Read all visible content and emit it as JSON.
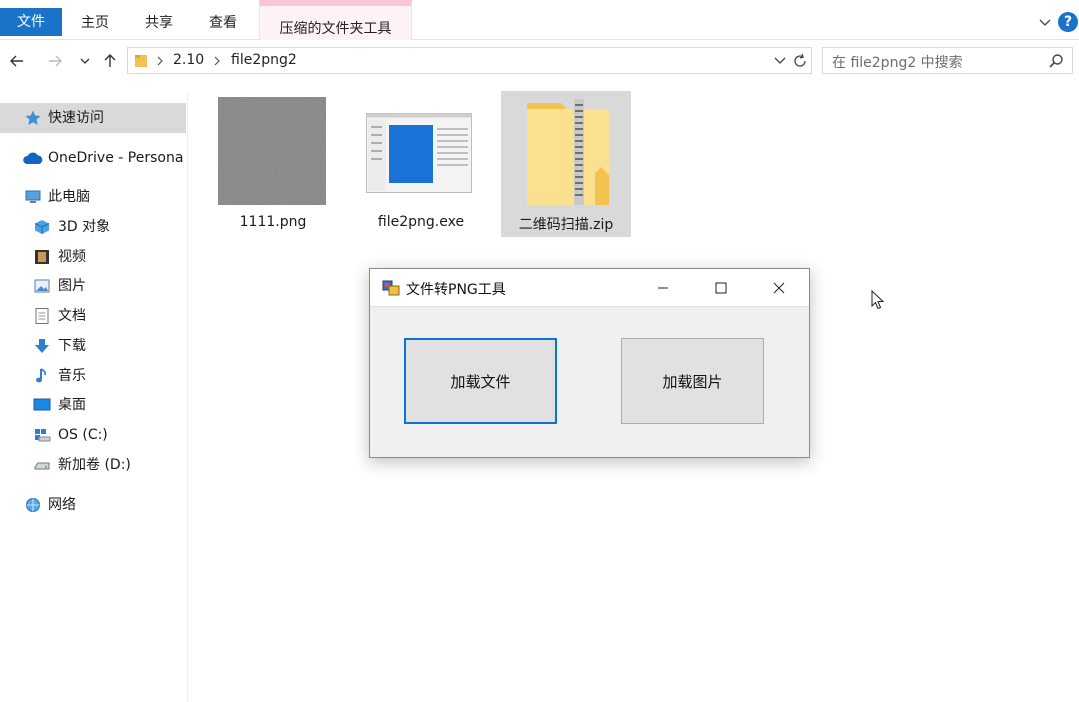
{
  "ribbon": {
    "tabs": [
      "文件",
      "主页",
      "共享",
      "查看"
    ],
    "context_tab": "压缩的文件夹工具",
    "help": "?"
  },
  "address": {
    "segments": [
      "2.10",
      "file2png2"
    ]
  },
  "search": {
    "placeholder": "在 file2png2 中搜索"
  },
  "sidebar": {
    "items": [
      {
        "label": "快速访问",
        "icon": "star-icon"
      },
      {
        "label": "OneDrive - Persona",
        "icon": "cloud-icon"
      },
      {
        "label": "此电脑",
        "icon": "computer-icon"
      },
      {
        "label": "3D 对象",
        "icon": "cube-icon"
      },
      {
        "label": "视频",
        "icon": "film-icon"
      },
      {
        "label": "图片",
        "icon": "picture-icon"
      },
      {
        "label": "文档",
        "icon": "document-icon"
      },
      {
        "label": "下载",
        "icon": "download-icon"
      },
      {
        "label": "音乐",
        "icon": "music-icon"
      },
      {
        "label": "桌面",
        "icon": "desktop-icon"
      },
      {
        "label": "OS (C:)",
        "icon": "drive-os-icon"
      },
      {
        "label": "新加卷 (D:)",
        "icon": "drive-icon"
      },
      {
        "label": "网络",
        "icon": "network-icon"
      }
    ]
  },
  "files": [
    {
      "name": "1111.png",
      "icon": "noise-image-thumbnail"
    },
    {
      "name": "file2png.exe",
      "icon": "exe-window-thumbnail"
    },
    {
      "name": "二维码扫描.zip",
      "icon": "zip-folder-icon"
    }
  ],
  "dialog": {
    "title": "文件转PNG工具",
    "load_file_label": "加载文件",
    "load_image_label": "加载图片"
  },
  "colors": {
    "accent": "#1a73c8",
    "context_tab": "#f7c6d8",
    "focus_border": "#0a74d4"
  }
}
